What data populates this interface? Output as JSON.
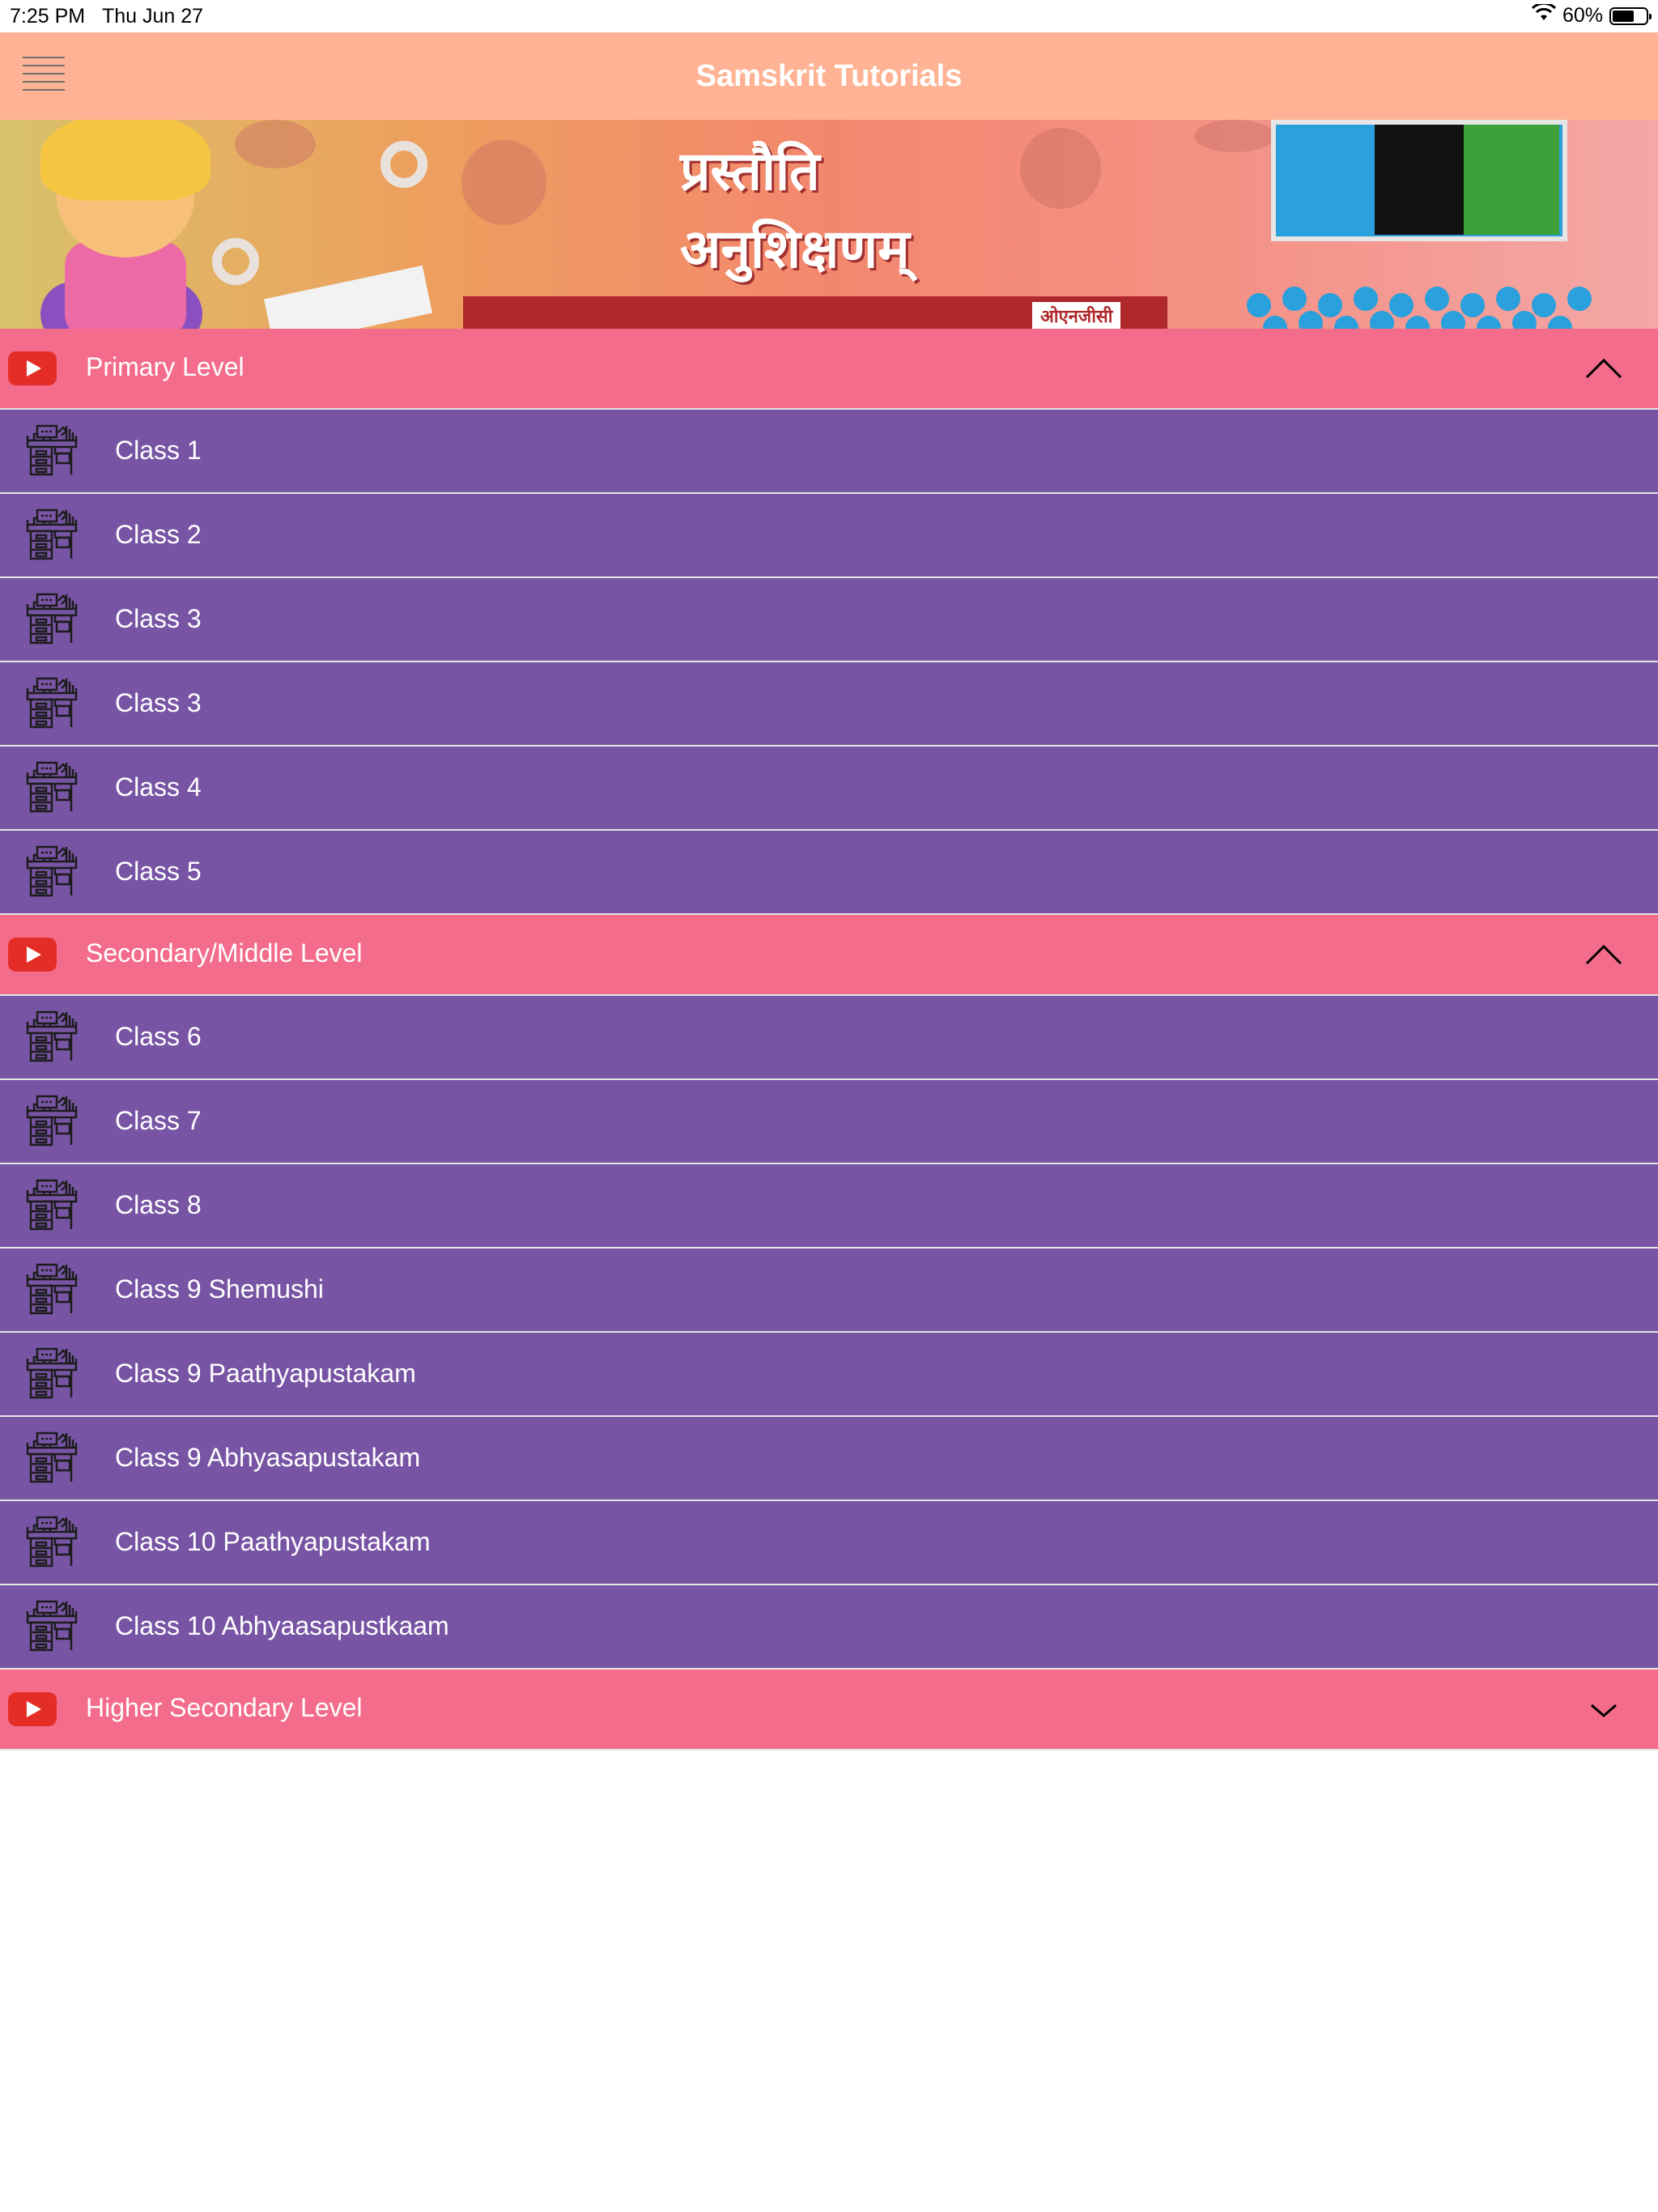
{
  "status_bar": {
    "time": "7:25 PM",
    "date": "Thu Jun 27",
    "battery": "60%",
    "battery_level": 0.6
  },
  "nav": {
    "title": "Samskrit Tutorials",
    "menu_icon": "hamburger-icon"
  },
  "banner": {
    "title_line1": "प्रस्तौति",
    "title_line2": "अनुशिक्षणम्",
    "badge": "ओएनजीसी"
  },
  "colors": {
    "nav_bg": "#ffb394",
    "section_bg": "#f36c8c",
    "row_bg": "#7855a4",
    "divider": "#e5e5e5",
    "youtube_red": "#e52d27"
  },
  "sections": [
    {
      "label": "Primary Level",
      "expanded": true,
      "icon": "youtube-play-icon",
      "items": [
        "Class 1",
        "Class 2",
        "Class 3",
        "Class 3",
        "Class 4",
        "Class 5"
      ]
    },
    {
      "label": "Secondary/Middle Level",
      "expanded": true,
      "icon": "youtube-play-icon",
      "items": [
        "Class 6",
        "Class 7",
        "Class 8",
        "Class 9 Shemushi",
        "Class 9 Paathyapustakam",
        "Class 9 Abhyasapustakam",
        "Class 10 Paathyapustakam",
        "Class 10 Abhyaasapustkaam"
      ]
    },
    {
      "label": "Higher Secondary Level",
      "expanded": false,
      "icon": "youtube-play-icon",
      "items": []
    }
  ],
  "row_icon": "classroom-desk-icon"
}
